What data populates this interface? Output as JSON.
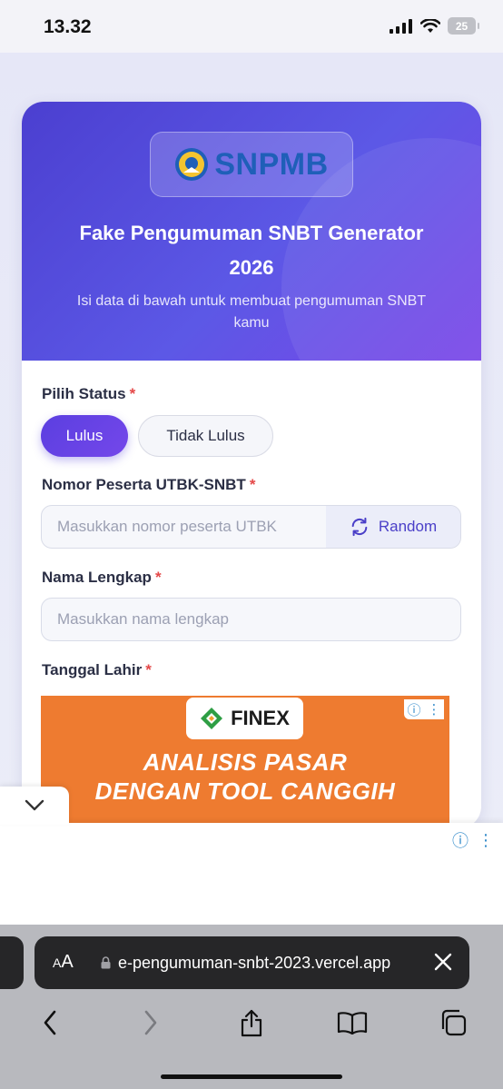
{
  "status_bar": {
    "time": "13.32",
    "battery": "25"
  },
  "header": {
    "logo_text": "SNPMB",
    "title_line1": "Fake Pengumuman SNBT Generator",
    "title_line2": "2026",
    "subtitle_line1": "Isi data di bawah untuk membuat pengumuman SNBT",
    "subtitle_line2": "kamu"
  },
  "form": {
    "status_label": "Pilih Status",
    "status_options": [
      "Lulus",
      "Tidak Lulus"
    ],
    "selected_status": "Lulus",
    "nomor_label": "Nomor Peserta UTBK-SNBT",
    "nomor_placeholder": "Masukkan nomor peserta UTBK",
    "random_label": "Random",
    "nama_label": "Nama Lengkap",
    "nama_placeholder": "Masukkan nama lengkap",
    "tanggal_label": "Tanggal Lahir",
    "required_mark": "*"
  },
  "ad": {
    "brand": "FINEX",
    "line1": "ANALISIS PASAR",
    "line2": "DENGAN TOOL CANGGIH"
  },
  "browser": {
    "aa_label_small": "A",
    "aa_label_large": "A",
    "url": "e-pengumuman-snbt-2023.vercel.app"
  },
  "colors": {
    "accent": "#5b3fe0",
    "required": "#e44848",
    "ad_orange": "#ee7b30"
  }
}
